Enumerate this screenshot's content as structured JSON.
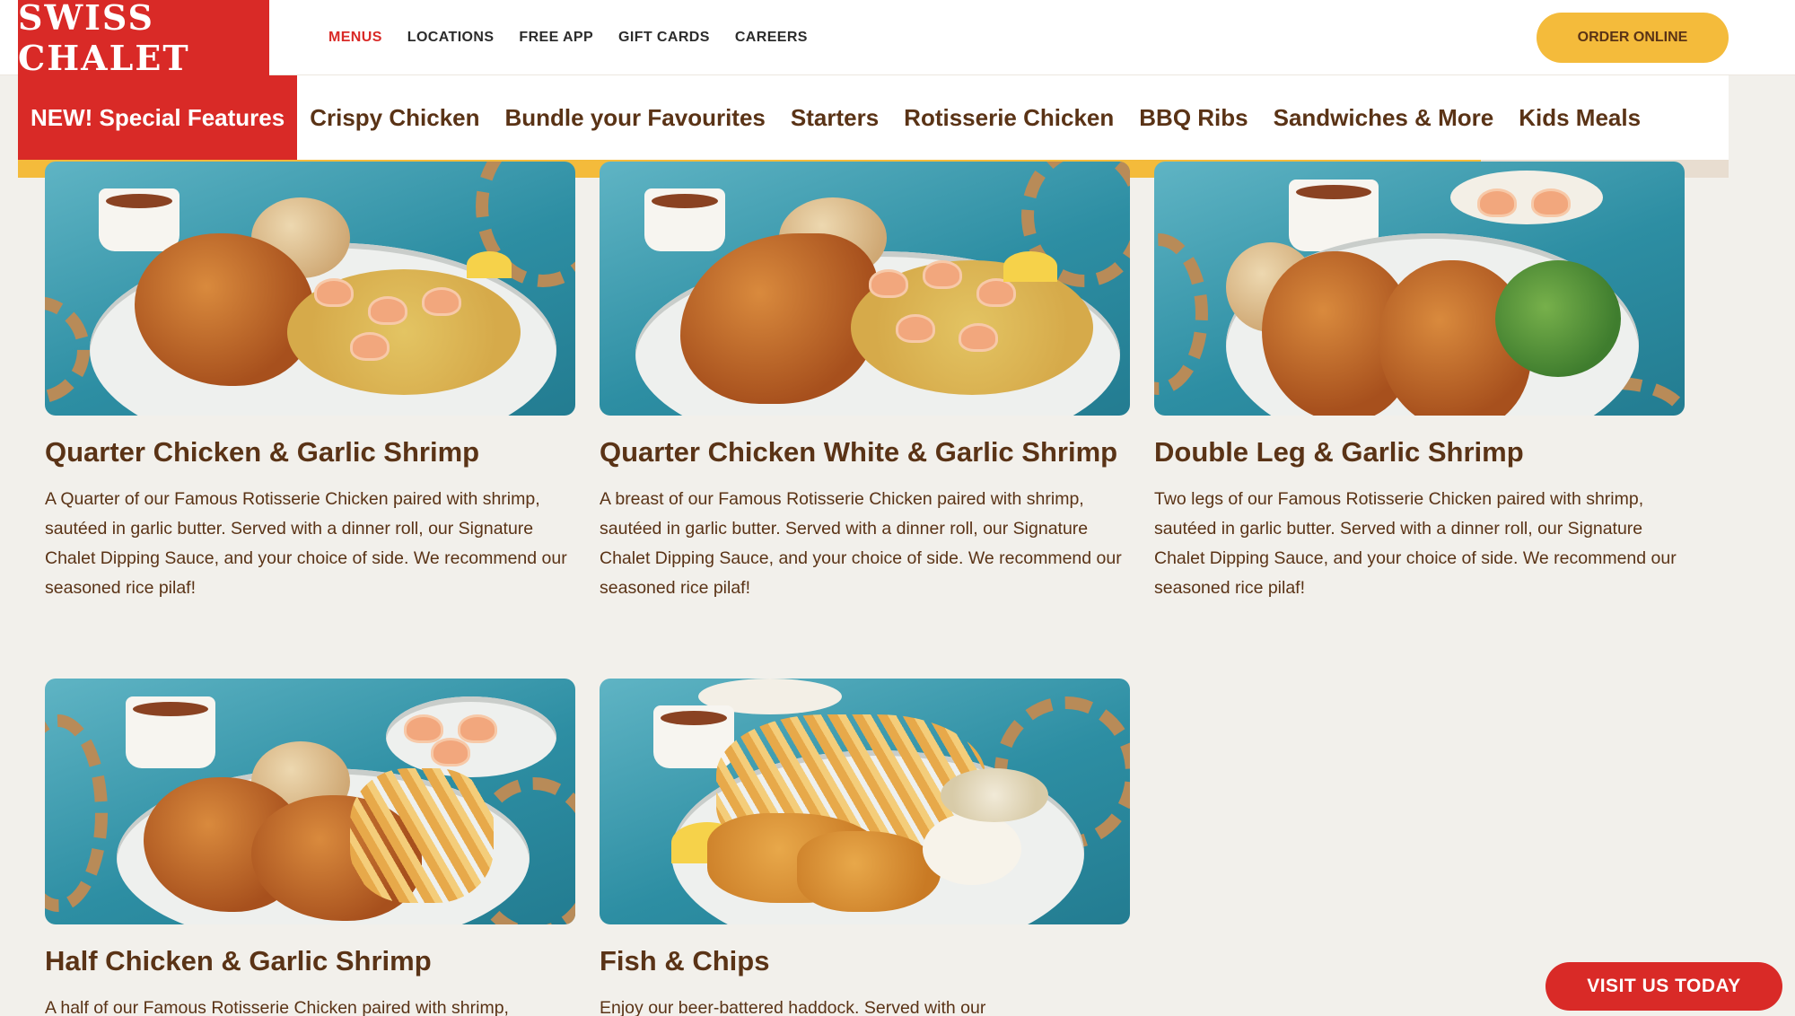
{
  "brand": {
    "logo_text": "SWISS CHALET"
  },
  "top_nav": {
    "items": [
      {
        "label": "MENUS",
        "active": true
      },
      {
        "label": "LOCATIONS"
      },
      {
        "label": "FREE APP"
      },
      {
        "label": "GIFT CARDS"
      },
      {
        "label": "CAREERS"
      }
    ],
    "order_label": "ORDER ONLINE"
  },
  "categories": [
    {
      "label": "NEW! Special Features",
      "active": true
    },
    {
      "label": "Crispy Chicken"
    },
    {
      "label": "Bundle your Favourites"
    },
    {
      "label": "Starters"
    },
    {
      "label": "Rotisserie Chicken"
    },
    {
      "label": "BBQ Ribs"
    },
    {
      "label": "Sandwiches & More"
    },
    {
      "label": "Kids Meals"
    }
  ],
  "scroll_progress": 0.855,
  "menu_items": [
    {
      "title": "Quarter Chicken & Garlic Shrimp",
      "description": "A Quarter of our Famous Rotisserie Chicken paired with shrimp, sautéed in garlic butter. Served with a dinner roll, our Signature Chalet Dipping Sauce, and your choice of side. We recommend our seasoned rice pilaf!"
    },
    {
      "title": "Quarter Chicken White & Garlic Shrimp",
      "description": "A breast of our Famous Rotisserie Chicken paired with shrimp, sautéed in garlic butter. Served with a dinner roll, our Signature Chalet Dipping Sauce, and your choice of side. We recommend our seasoned rice pilaf!"
    },
    {
      "title": "Double Leg & Garlic Shrimp",
      "description": "Two legs of our Famous Rotisserie Chicken paired with shrimp, sautéed in garlic butter. Served with a dinner roll, our Signature Chalet Dipping Sauce, and your choice of side. We recommend our seasoned rice pilaf!"
    },
    {
      "title": "Half Chicken & Garlic Shrimp",
      "description": "A half of our Famous Rotisserie Chicken paired with shrimp,"
    },
    {
      "title": "Fish & Chips",
      "description": "Enjoy our beer-battered haddock. Served with our"
    }
  ],
  "visit_label": "VISIT US TODAY",
  "colors": {
    "brand_red": "#d92a27",
    "brand_yellow": "#f4bb3b",
    "brown_text": "#5a3316",
    "page_bg": "#f2f0eb"
  }
}
